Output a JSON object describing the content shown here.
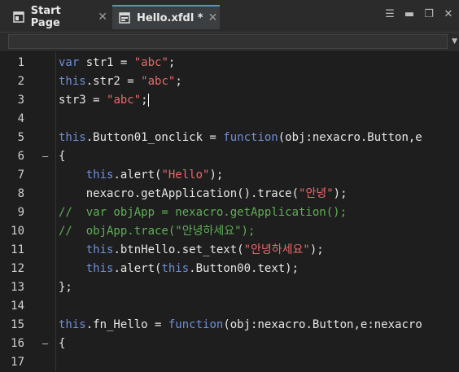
{
  "tabs": [
    {
      "label": "Start Page",
      "icon": "start-page-icon"
    },
    {
      "label": "Hello.xfdl *",
      "icon": "form-file-icon"
    }
  ],
  "window_controls": [
    "menu-list-icon",
    "minimize-icon",
    "restore-icon",
    "close-icon"
  ],
  "colors": {
    "keyword": "#6f8fd8",
    "string": "#e86a6a",
    "comment": "#5fae56",
    "text": "#e6e6e6",
    "background": "#1e1e1e"
  },
  "lines": [
    {
      "n": "1",
      "tokens": [
        [
          "kw",
          "var"
        ],
        [
          "txt",
          " str1 = "
        ],
        [
          "str",
          "\"abc\""
        ],
        [
          "txt",
          ";"
        ]
      ]
    },
    {
      "n": "2",
      "tokens": [
        [
          "kw",
          "this"
        ],
        [
          "txt",
          ".str2 = "
        ],
        [
          "str",
          "\"abc\""
        ],
        [
          "txt",
          ";"
        ]
      ]
    },
    {
      "n": "3",
      "tokens": [
        [
          "txt",
          "str3 = "
        ],
        [
          "str",
          "\"abc\""
        ],
        [
          "txt",
          ";"
        ],
        [
          "caret",
          ""
        ]
      ]
    },
    {
      "n": "4",
      "tokens": []
    },
    {
      "n": "5",
      "tokens": [
        [
          "kw",
          "this"
        ],
        [
          "txt",
          ".Button01_onclick = "
        ],
        [
          "kw",
          "function"
        ],
        [
          "txt",
          "(obj:nexacro.Button,e"
        ]
      ]
    },
    {
      "n": "6",
      "fold": true,
      "tokens": [
        [
          "txt",
          "{"
        ]
      ]
    },
    {
      "n": "7",
      "tokens": [
        [
          "txt",
          "    "
        ],
        [
          "kw",
          "this"
        ],
        [
          "txt",
          ".alert("
        ],
        [
          "str",
          "\"Hello\""
        ],
        [
          "txt",
          ");"
        ]
      ]
    },
    {
      "n": "8",
      "tokens": [
        [
          "txt",
          "    nexacro.getApplication().trace("
        ],
        [
          "str",
          "\"안녕\""
        ],
        [
          "txt",
          ");"
        ]
      ]
    },
    {
      "n": "9",
      "tokens": [
        [
          "cm",
          "//  var objApp = nexacro.getApplication();"
        ]
      ]
    },
    {
      "n": "10",
      "tokens": [
        [
          "cm",
          "//  objApp.trace(\"안녕하세요\");"
        ]
      ]
    },
    {
      "n": "11",
      "tokens": [
        [
          "txt",
          "    "
        ],
        [
          "kw",
          "this"
        ],
        [
          "txt",
          ".btnHello.set_text("
        ],
        [
          "str",
          "\"안녕하세요\""
        ],
        [
          "txt",
          ");"
        ]
      ]
    },
    {
      "n": "12",
      "tokens": [
        [
          "txt",
          "    "
        ],
        [
          "kw",
          "this"
        ],
        [
          "txt",
          ".alert("
        ],
        [
          "kw",
          "this"
        ],
        [
          "txt",
          ".Button00.text);"
        ]
      ]
    },
    {
      "n": "13",
      "tokens": [
        [
          "txt",
          "};"
        ]
      ]
    },
    {
      "n": "14",
      "tokens": []
    },
    {
      "n": "15",
      "tokens": [
        [
          "kw",
          "this"
        ],
        [
          "txt",
          ".fn_Hello = "
        ],
        [
          "kw",
          "function"
        ],
        [
          "txt",
          "(obj:nexacro.Button,e:nexacro"
        ]
      ]
    },
    {
      "n": "16",
      "fold": true,
      "tokens": [
        [
          "txt",
          "{"
        ]
      ]
    },
    {
      "n": "17",
      "tokens": []
    }
  ]
}
